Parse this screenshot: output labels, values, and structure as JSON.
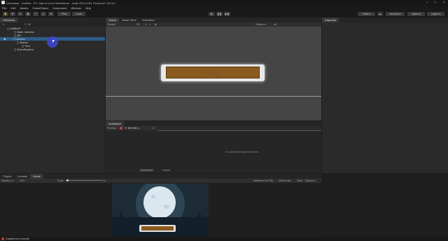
{
  "window": {
    "title": "Gameplay - Untitled - PC, Mac & Linux Standalone - Unity 2019.4.9f1 Personal* <DX11>"
  },
  "menu": [
    "File",
    "Edit",
    "Assets",
    "GameObject",
    "Component",
    "Window",
    "Help"
  ],
  "toolbar": {
    "pivot": "Pivot",
    "local": "Local",
    "collab": "Collab ▾",
    "account": "Account ▾",
    "layers": "Layers ▾",
    "layout": "Layout ▾"
  },
  "hierarchy": {
    "tab": "Hierarchy",
    "search_placeholder": "All",
    "items": [
      {
        "label": "Untitled*"
      },
      {
        "label": "Main Camera"
      },
      {
        "label": "BG"
      },
      {
        "label": "Canvas"
      },
      {
        "label": "Button"
      },
      {
        "label": "Text"
      },
      {
        "label": "EventSystem"
      }
    ]
  },
  "scene": {
    "tabs": [
      "Scene",
      "Asset Store",
      "Animation"
    ],
    "shading": "Shaded",
    "mode": "2D",
    "gizmos": "Gizmos ▾",
    "search": "All",
    "button_text": "Play"
  },
  "animation": {
    "tab": "Animation",
    "preview": "Preview",
    "frame": "0",
    "empty_message": "No animatable object selected.",
    "bottom_tabs": [
      "Dopesheet",
      "Curves"
    ]
  },
  "inspector": {
    "tab": "Inspector"
  },
  "bottom": {
    "tabs": [
      "Project",
      "Console",
      "Game"
    ],
    "display": "Display 1 ▾",
    "aspect": "16:9",
    "scale_label": "Scale",
    "scale_value": "1x",
    "options": [
      "Maximize On Play",
      "Mute Audio",
      "Stats",
      "Gizmos ▾"
    ]
  },
  "statusbar": {
    "message": "Gradient error format!"
  },
  "colors": {
    "accent_selection": "#2c5d87",
    "wood_button": "#8a5a1e",
    "moon": "#dbe7ef",
    "night_sky": "#1c2b35",
    "error_red": "#d23c3c"
  }
}
